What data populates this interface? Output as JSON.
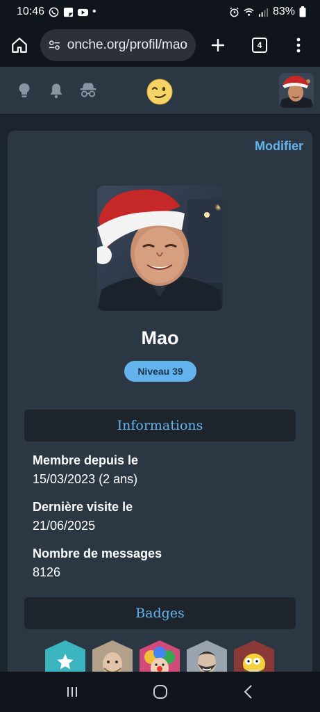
{
  "status": {
    "time": "10:46",
    "dot": "•",
    "battery": "83%"
  },
  "browser": {
    "url": "onche.org/profil/mao",
    "tab_count": "4"
  },
  "profile": {
    "edit_label": "Modifier",
    "username": "Mao",
    "level": "Niveau 39"
  },
  "info_section": {
    "title": "Informations",
    "member_since_label": "Membre depuis le",
    "member_since_value": "15/03/2023 (2 ans)",
    "last_visit_label": "Dernière visite le",
    "last_visit_value": "21/06/2025",
    "messages_label": "Nombre de messages",
    "messages_value": "8126"
  },
  "badges_section": {
    "title": "Badges",
    "badges": [
      "star-badge",
      "bald-man-badge",
      "clown-badge",
      "bearded-man-badge",
      "cartoon-grandpa-badge"
    ]
  },
  "colors": {
    "accent": "#63b3ed",
    "card": "#2c3744",
    "background": "#1c242e"
  }
}
